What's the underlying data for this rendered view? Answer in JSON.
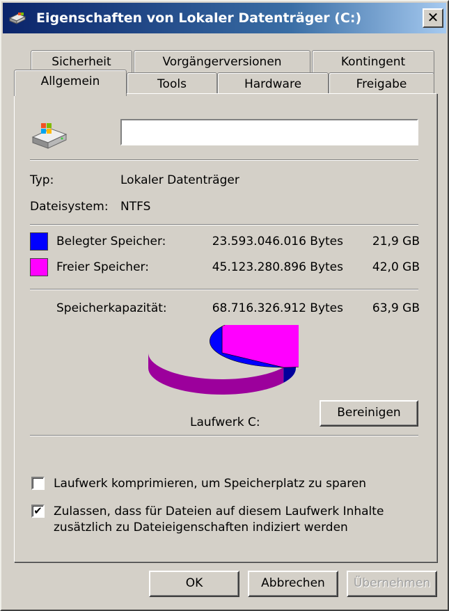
{
  "window": {
    "title": "Eigenschaften von Lokaler Datenträger (C:)",
    "close_label": "✕"
  },
  "tabs_row_top": [
    "Sicherheit",
    "Vorgängerversionen",
    "Kontingent"
  ],
  "tabs_row_bottom": [
    "Allgemein",
    "Tools",
    "Hardware",
    "Freigabe"
  ],
  "active_tab": "Allgemein",
  "general": {
    "name_value": "",
    "type_label": "Typ:",
    "type_value": "Lokaler Datenträger",
    "fs_label": "Dateisystem:",
    "fs_value": "NTFS",
    "used_label": "Belegter Speicher:",
    "used_bytes": "23.593.046.016 Bytes",
    "used_gb": "21,9 GB",
    "free_label": "Freier Speicher:",
    "free_bytes": "45.123.280.896 Bytes",
    "free_gb": "42,0 GB",
    "capacity_label": "Speicherkapazität:",
    "capacity_bytes": "68.716.326.912 Bytes",
    "capacity_gb": "63,9 GB",
    "drive_label": "Laufwerk C:",
    "cleanup_button": "Bereinigen",
    "compress_label": "Laufwerk komprimieren, um Speicherplatz zu sparen",
    "compress_checked": false,
    "index_label_line1": "Zulassen, dass für Dateien auf diesem Laufwerk Inhalte",
    "index_label_line2": "zusätzlich zu Dateieigenschaften indiziert werden",
    "index_checked": true
  },
  "colors": {
    "used": "#0000ff",
    "used_side": "#00009c",
    "free": "#ff00ff",
    "free_side": "#9c009c"
  },
  "usage": {
    "used_fraction": 0.3433,
    "free_fraction": 0.6567
  },
  "icons": {
    "title": "drive-icon",
    "drive": "hard-drive-icon"
  },
  "footer": {
    "ok": "OK",
    "cancel": "Abbrechen",
    "apply": "Übernehmen"
  }
}
